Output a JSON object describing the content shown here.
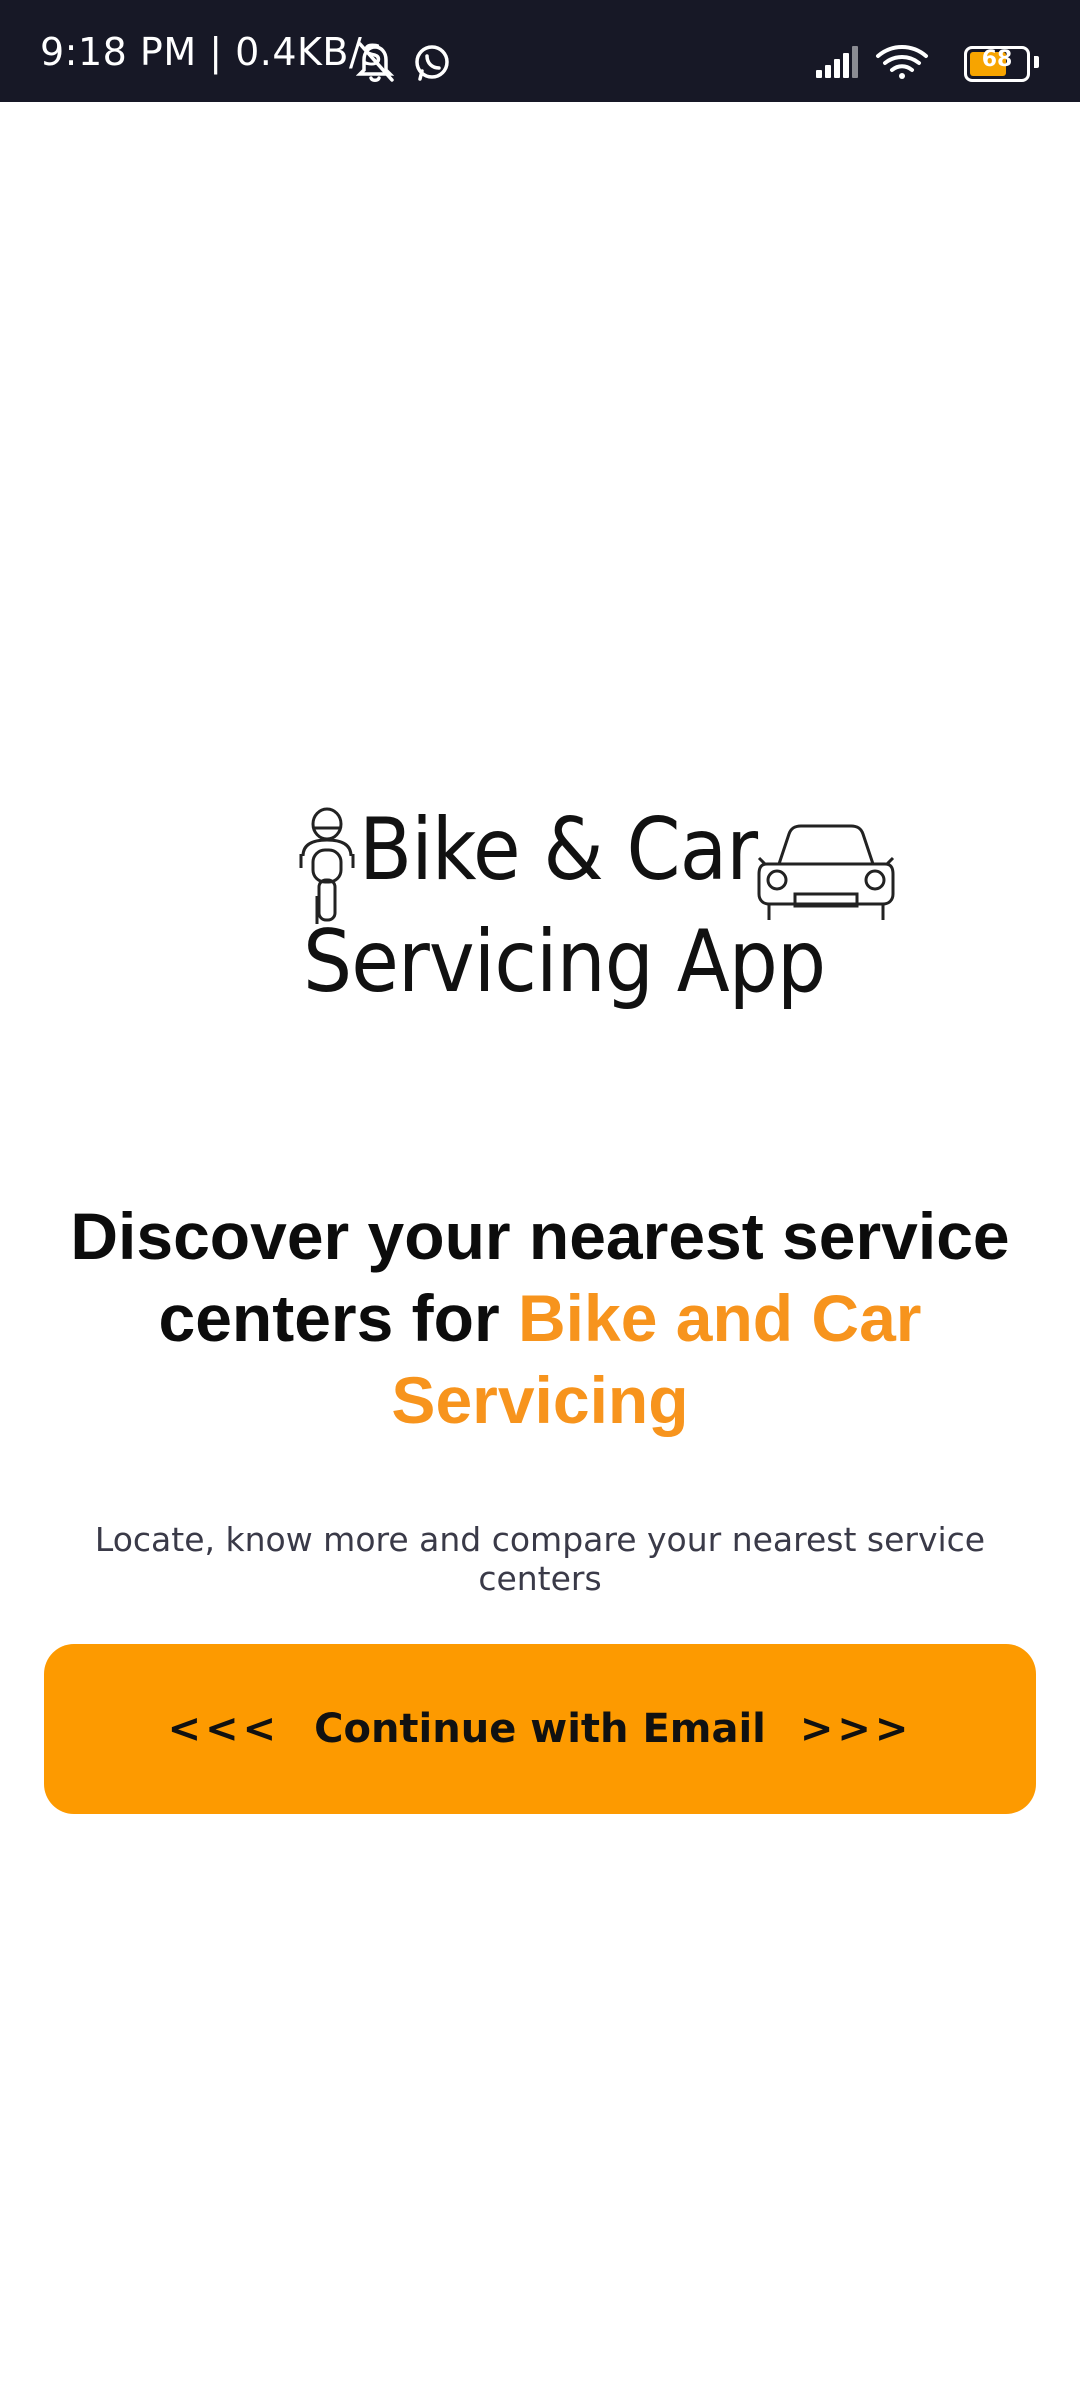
{
  "status_bar": {
    "time_speed": "9:18 PM | 0.4KB/s",
    "battery_level": "68",
    "battery_color": "#f7a400",
    "icons": [
      "muted-bell-icon",
      "whatsapp-icon",
      "signal-icon",
      "wifi-icon",
      "battery-icon"
    ]
  },
  "logo": {
    "line1": "Bike & Car",
    "line2": "Servicing App",
    "icons": [
      "motorbike-icon",
      "car-icon"
    ]
  },
  "headline": {
    "part1": "Discover your nearest service centers for ",
    "accent": "Bike and Car Servicing",
    "accent_color": "#f7941d"
  },
  "subtitle": "Locate, know more and compare your nearest service centers",
  "cta": {
    "left_arrows": "<<<",
    "label": "Continue with Email",
    "right_arrows": ">>>",
    "color": "#fd9a00"
  }
}
